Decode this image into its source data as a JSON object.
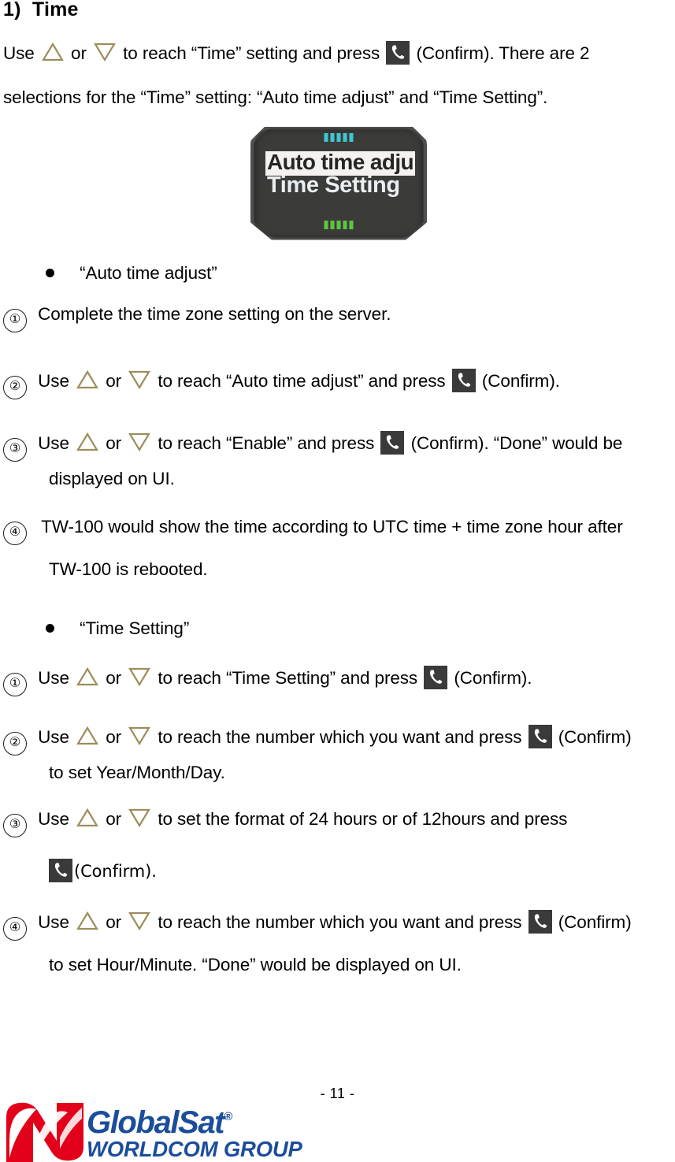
{
  "document": {
    "heading": "1)  Time",
    "page_number": "- 11 -"
  },
  "intro": {
    "line1_a": "Use",
    "line1_b": "or",
    "line1_c": "to reach “Time” setting and press",
    "line1_d": "(Confirm). There are 2",
    "line2": "selections for the “Time” setting: “Auto time adjust” and “Time Setting”."
  },
  "device": {
    "screen_line_selected": "Auto time adju",
    "screen_line_second": "Time Setting",
    "top_indicator_color": "#3fc7cf",
    "bottom_indicator_color": "#5cc441",
    "body_color": "#3b3b39"
  },
  "section_auto": {
    "bullet_label": "“Auto time adjust”",
    "steps": [
      {
        "num": "①",
        "parts": [
          {
            "type": "text",
            "value": "Complete the time zone setting on the server."
          }
        ],
        "continuation": null
      },
      {
        "num": "②",
        "parts": [
          {
            "type": "text",
            "value": "Use"
          },
          {
            "type": "icon",
            "value": "triangle-up"
          },
          {
            "type": "text",
            "value": "or"
          },
          {
            "type": "icon",
            "value": "triangle-down"
          },
          {
            "type": "text",
            "value": "to reach “Auto time adjust” and press"
          },
          {
            "type": "icon",
            "value": "phone"
          },
          {
            "type": "text",
            "value": "(Confirm)."
          }
        ],
        "continuation": null
      },
      {
        "num": "③",
        "parts": [
          {
            "type": "text",
            "value": "Use"
          },
          {
            "type": "icon",
            "value": "triangle-up"
          },
          {
            "type": "text",
            "value": "or"
          },
          {
            "type": "icon",
            "value": "triangle-down"
          },
          {
            "type": "text",
            "value": "to reach “Enable” and press"
          },
          {
            "type": "icon",
            "value": "phone"
          },
          {
            "type": "text",
            "value": "(Confirm). “Done” would be"
          }
        ],
        "continuation": "displayed on UI."
      },
      {
        "num": "④",
        "parts": [
          {
            "type": "text",
            "value": "TW-100 would show the time according to UTC time + time zone hour after"
          }
        ],
        "continuation": "TW-100 is rebooted."
      }
    ]
  },
  "section_time_setting": {
    "bullet_label": "“Time Setting”",
    "steps": [
      {
        "num": "①",
        "parts": [
          {
            "type": "text",
            "value": "Use"
          },
          {
            "type": "icon",
            "value": "triangle-up"
          },
          {
            "type": "text",
            "value": "or"
          },
          {
            "type": "icon",
            "value": "triangle-down"
          },
          {
            "type": "text",
            "value": "to reach “Time Setting” and press"
          },
          {
            "type": "icon",
            "value": "phone"
          },
          {
            "type": "text",
            "value": "(Confirm)."
          }
        ],
        "continuation": null
      },
      {
        "num": "②",
        "parts": [
          {
            "type": "text",
            "value": "Use"
          },
          {
            "type": "icon",
            "value": "triangle-up"
          },
          {
            "type": "text",
            "value": "or"
          },
          {
            "type": "icon",
            "value": "triangle-down"
          },
          {
            "type": "text",
            "value": "to reach the number which you want and press"
          },
          {
            "type": "icon",
            "value": "phone"
          },
          {
            "type": "text",
            "value": "(Confirm)"
          }
        ],
        "continuation": "to set Year/Month/Day."
      },
      {
        "num": "③",
        "parts": [
          {
            "type": "text",
            "value": "Use"
          },
          {
            "type": "icon",
            "value": "triangle-up"
          },
          {
            "type": "text",
            "value": "or"
          },
          {
            "type": "icon",
            "value": "triangle-down"
          },
          {
            "type": "text",
            "value": "to set the format of 24 hours or of 12hours and press"
          }
        ],
        "continuation": "(Confirm)."
      },
      {
        "num": "④",
        "parts": [
          {
            "type": "text",
            "value": "Use"
          },
          {
            "type": "icon",
            "value": "triangle-up"
          },
          {
            "type": "text",
            "value": "or"
          },
          {
            "type": "icon",
            "value": "triangle-down"
          },
          {
            "type": "text",
            "value": "to reach the number which you want and press"
          },
          {
            "type": "icon",
            "value": "phone"
          },
          {
            "type": "text",
            "value": "(Confirm)"
          }
        ],
        "continuation": "to set Hour/Minute. “Done” would be displayed on UI."
      }
    ]
  },
  "footer": {
    "logo_main": "GlobalSat",
    "logo_registered": "®",
    "logo_sub": "WORLDCOM GROUP",
    "logo_mark_color": "#e2001a",
    "logo_text_color": "#1b4d9b"
  },
  "colors": {
    "triangle_stroke": "#9c8d5c",
    "phone_bg": "#3a3a3a",
    "phone_glyph": "#ffffff"
  }
}
